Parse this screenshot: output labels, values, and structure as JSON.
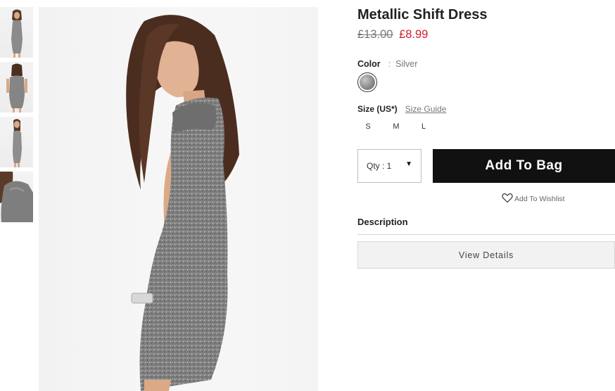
{
  "product": {
    "title": "Metallic Shift Dress",
    "price_original": "£13.00",
    "price_sale": "£8.99"
  },
  "color": {
    "label": "Color",
    "separator": ":",
    "value": "Silver"
  },
  "size": {
    "label": "Size (US*)",
    "guide_link": "Size Guide",
    "options": [
      "S",
      "M",
      "L"
    ]
  },
  "purchase": {
    "quantity_label": "Qty : 1",
    "add_to_bag": "Add To Bag",
    "wishlist": "Add To Wishlist"
  },
  "description": {
    "label": "Description",
    "view_details": "View Details"
  },
  "gallery": {
    "thumbnail_count": 4,
    "icons": [
      "dress-thumbnail-front",
      "dress-thumbnail-back",
      "dress-thumbnail-side",
      "dress-thumbnail-detail"
    ]
  },
  "colors": {
    "sale_price": "#d0202a",
    "button_bg": "#111111",
    "dress": "#8a8a8a"
  }
}
